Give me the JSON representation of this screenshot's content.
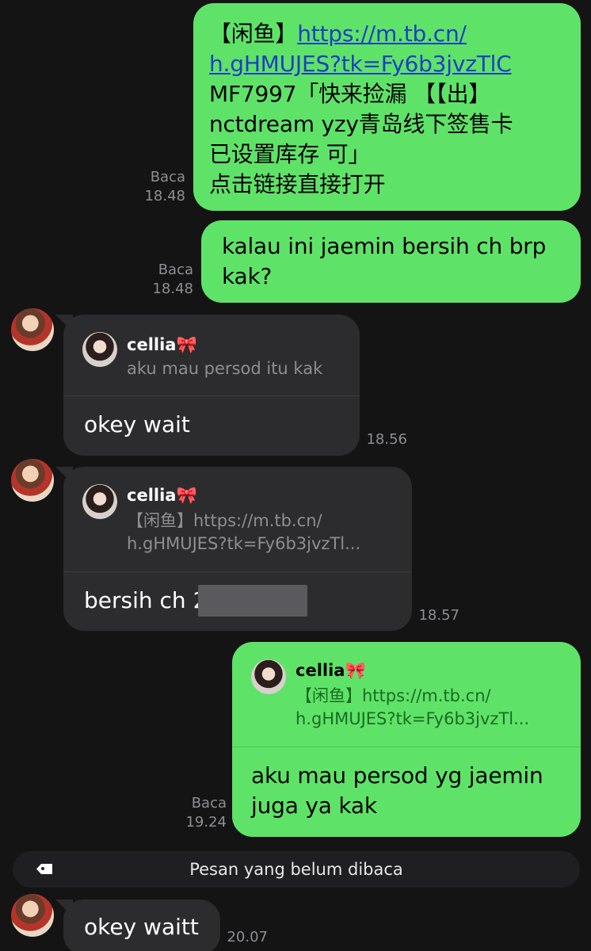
{
  "messages": {
    "m1": {
      "direction": "outgoing",
      "line1_prefix": "【闲鱼】",
      "line1_link": "https://m.tb.cn/",
      "line2_link": "h.gHMUJES?tk=Fy6b3jvzTlC",
      "line3": "MF7997「快来捡漏 【【出】",
      "line4": "nctdream yzy青岛线下签售卡",
      "line5": "已设置库存 可」",
      "line6": "点击链接直接打开",
      "status": "Baca",
      "time": "18.48"
    },
    "m2": {
      "direction": "outgoing",
      "line1": "kalau ini jaemin bersih ch brp",
      "line2": "kak?",
      "status": "Baca",
      "time": "18.48"
    },
    "m3": {
      "direction": "incoming",
      "reply_name": "cellia",
      "reply_emoji": "🎀",
      "reply_snippet": "aku mau persod itu kak",
      "text": "okey wait",
      "time": "18.56"
    },
    "m4": {
      "direction": "incoming",
      "reply_name": "cellia",
      "reply_emoji": "🎀",
      "reply_snippet_line1": "【闲鱼】https://m.tb.cn/",
      "reply_snippet_line2": "h.gHMUJES?tk=Fy6b3jvzTl...",
      "text": "bersih ch 2",
      "time": "18.57"
    },
    "m5": {
      "direction": "outgoing",
      "reply_name": "cellia",
      "reply_emoji": "🎀",
      "reply_snippet_line1": "【闲鱼】https://m.tb.cn/",
      "reply_snippet_line2": "h.gHMUJES?tk=Fy6b3jvzTl...",
      "line1": "aku mau persod yg jaemin",
      "line2": "juga ya kak",
      "status": "Baca",
      "time": "19.24"
    },
    "m6": {
      "direction": "incoming",
      "text": "okey waitt",
      "time": "20.07"
    }
  },
  "unread_divider": {
    "label": "Pesan yang belum dibaca",
    "icon": "tag-icon"
  },
  "colors": {
    "background": "#141414",
    "outgoing_bubble": "#5ee368",
    "incoming_bubble": "#2c2c2e",
    "link": "#1d3fc4",
    "meta_text": "#8e8e93"
  }
}
